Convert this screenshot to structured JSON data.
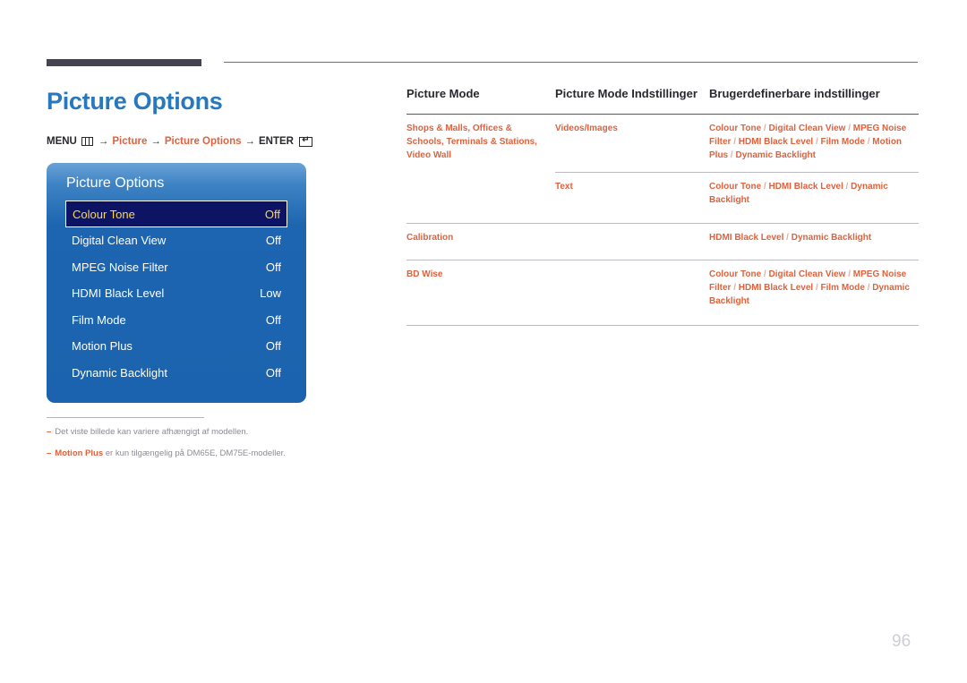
{
  "page_title": "Picture Options",
  "breadcrumb": {
    "menu_label": "MENU",
    "menu_icon": "menu-bars-icon",
    "arrow": "→",
    "crumb_1": "Picture",
    "crumb_2": "Picture Options",
    "enter_label": "ENTER",
    "enter_icon": "enter-return-icon"
  },
  "osd": {
    "title": "Picture Options",
    "rows": [
      {
        "label": "Colour Tone",
        "value": "Off",
        "selected": true
      },
      {
        "label": "Digital Clean View",
        "value": "Off",
        "selected": false
      },
      {
        "label": "MPEG Noise Filter",
        "value": "Off",
        "selected": false
      },
      {
        "label": "HDMI Black Level",
        "value": "Low",
        "selected": false
      },
      {
        "label": "Film Mode",
        "value": "Off",
        "selected": false
      },
      {
        "label": "Motion Plus",
        "value": "Off",
        "selected": false
      },
      {
        "label": "Dynamic Backlight",
        "value": "Off",
        "selected": false
      }
    ]
  },
  "footnotes": [
    {
      "dash": "–",
      "strong": "",
      "text": "Det viste billede kan variere afhængigt af modellen."
    },
    {
      "dash": "–",
      "strong": "Motion Plus",
      "text": " er kun tilgængelig på DM65E, DM75E-modeller."
    }
  ],
  "table": {
    "headers": {
      "col1": "Picture Mode",
      "col2": "Picture Mode Indstillinger",
      "col3": "Brugerdefinerbare indstillinger"
    },
    "rows": [
      {
        "col1": "Shops & Malls, Offices & Schools, Terminals & Stations, Video Wall",
        "col2": "Videos/Images",
        "col3": "Colour Tone / Digital Clean View / MPEG Noise Filter / HDMI Black Level / Film Mode / Motion Plus / Dynamic Backlight"
      },
      {
        "col1": "",
        "col2": "Text",
        "col3": "Colour Tone / HDMI Black Level / Dynamic Backlight"
      },
      {
        "col1": "Calibration",
        "col2": "",
        "col3": "HDMI Black Level / Dynamic Backlight"
      },
      {
        "col1": "BD Wise",
        "col2": "",
        "col3": "Colour Tone / Digital Clean View / MPEG Noise Filter / HDMI Black Level / Film Mode / Dynamic Backlight"
      }
    ]
  },
  "page_number": "96",
  "colors": {
    "accent_orange": "#e1613c",
    "title_blue": "#2878bd",
    "osd_blue": "#1b63ae",
    "osd_selected_bg": "#0d1464",
    "osd_selected_text": "#ffd84d",
    "rule_dark": "#454350"
  }
}
